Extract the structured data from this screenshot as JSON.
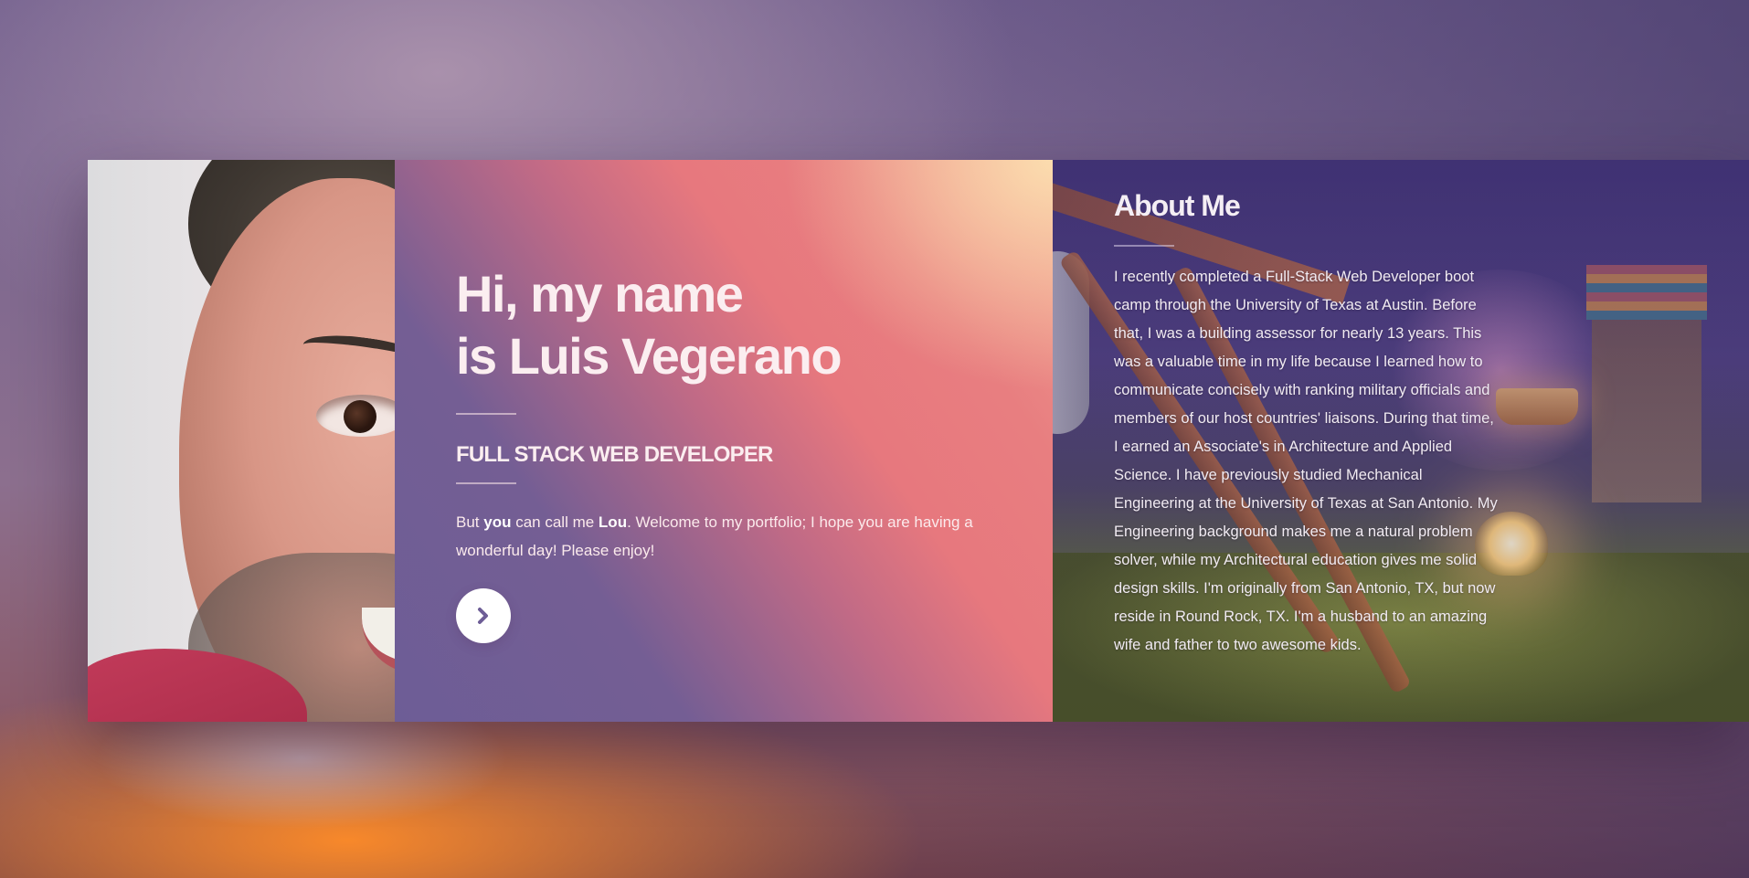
{
  "intro": {
    "headline_line1": "Hi, my name",
    "headline_line2": "is Luis Vegerano",
    "subtitle": "FULL STACK WEB DEVELOPER",
    "text_pre": "But ",
    "text_bold1": "you",
    "text_mid": " can call me ",
    "text_bold2": "Lou",
    "text_post": ". Welcome to my portfolio; I hope you are having a wonderful day! Please enjoy!",
    "next_icon": "chevron-right-icon"
  },
  "about": {
    "title": "About Me",
    "text": "I recently completed a Full-Stack Web Developer boot camp through the University of Texas at Austin. Before that, I was a building assessor for nearly 13 years. This was a valuable time in my life because I learned how to communicate concisely with ranking military officials and members of our host countries' liaisons. During that time, I earned an Associate's in Architecture and Applied Science. I have previously studied Mechanical Engineering at the University of Texas at San Antonio. My Engineering background makes me a natural problem solver, while my Architectural education gives me solid design skills. I'm originally from San Antonio, TX, but now reside in Round Rock, TX. I'm a husband to an amazing wife and father to two awesome kids."
  },
  "colors": {
    "accent": "#6d5d96",
    "intro_gradient_pink": "#e7787e",
    "intro_gradient_peach": "#fce0b0",
    "button_bg": "#ffffff"
  }
}
